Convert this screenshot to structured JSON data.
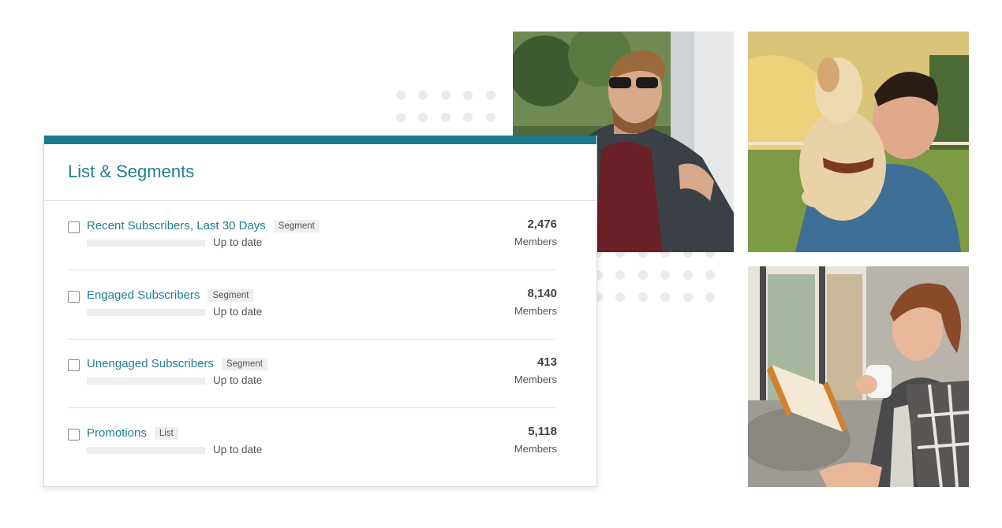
{
  "panel": {
    "title": "List & Segments",
    "rows": [
      {
        "name": "Recent Subscribers, Last 30 Days",
        "badge": "Segment",
        "status": "Up to date",
        "count": "2,476",
        "count_label": "Members"
      },
      {
        "name": "Engaged Subscribers",
        "badge": "Segment",
        "status": "Up to date",
        "count": "8,140",
        "count_label": "Members"
      },
      {
        "name": "Unengaged Subscribers",
        "badge": "Segment",
        "status": "Up to date",
        "count": "413",
        "count_label": "Members"
      },
      {
        "name": "Promotions",
        "badge": "List",
        "status": "Up to date",
        "count": "5,118",
        "count_label": "Members"
      }
    ]
  },
  "colors": {
    "accent": "#1a7a8c",
    "link": "#1f7e93",
    "badge_bg": "#eeeeee",
    "dot": "#ebebeb"
  },
  "photos": [
    {
      "icon": "man-sunglasses-photo"
    },
    {
      "icon": "man-with-dog-photo"
    },
    {
      "icon": "woman-reading-photo"
    }
  ]
}
